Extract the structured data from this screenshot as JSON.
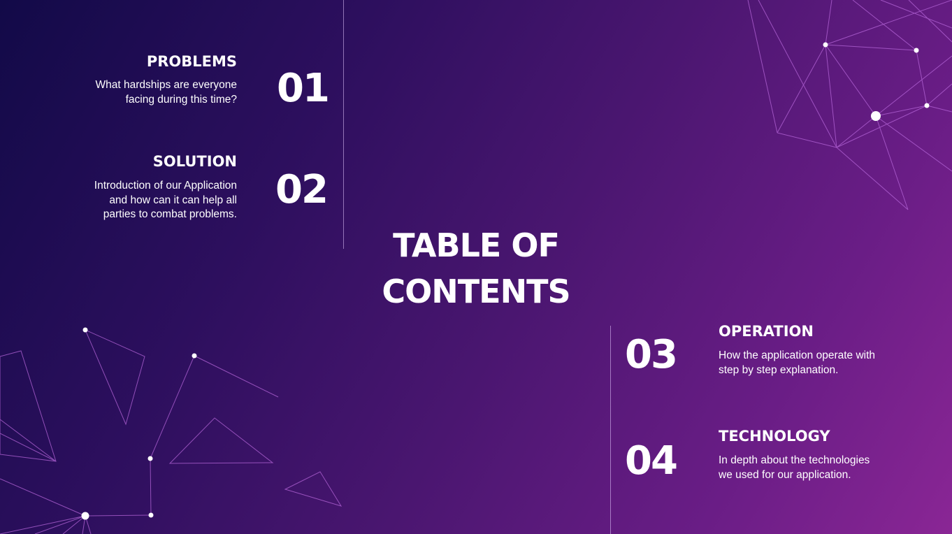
{
  "title_lines": [
    "TABLE OF",
    "CONTENTS"
  ],
  "sections": [
    {
      "number": "01",
      "heading": "PROBLEMS",
      "description": "What hardships are everyone facing during this time?"
    },
    {
      "number": "02",
      "heading": "SOLUTION",
      "description": "Introduction of our Application and how can it can help all parties to combat problems."
    },
    {
      "number": "03",
      "heading": "OPERATION",
      "description": "How the application operate with step by step explanation."
    },
    {
      "number": "04",
      "heading": "TECHNOLOGY",
      "description": "In depth about the technologies we used for our application."
    }
  ],
  "colors": {
    "text": "#ffffff",
    "bg_start": "#120a48",
    "bg_end": "#8a2695",
    "line": "#c37be0"
  }
}
